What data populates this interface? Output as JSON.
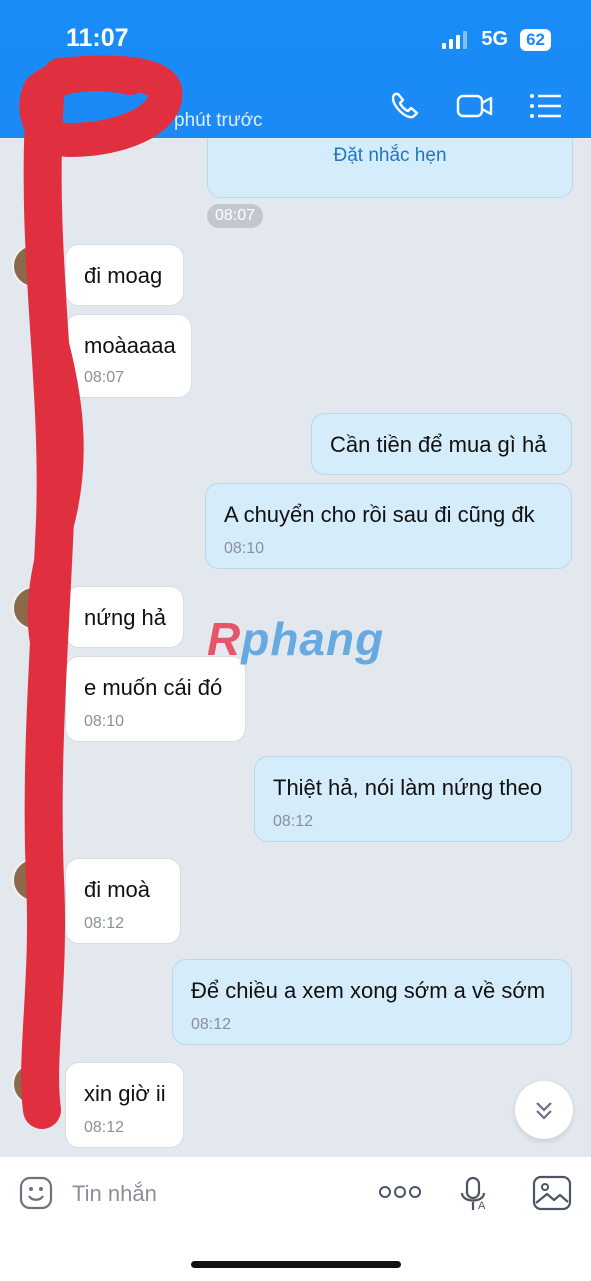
{
  "status_bar": {
    "time": "11:07",
    "network": "5G",
    "battery": "62"
  },
  "header": {
    "subtitle": "phút trước"
  },
  "reminder": {
    "label": "Đặt nhắc hẹn",
    "time": "08:07"
  },
  "messages": [
    {
      "side": "in",
      "text": "đi moag",
      "time": ""
    },
    {
      "side": "in",
      "text": "moàaaaa",
      "time": "08:07"
    },
    {
      "side": "out",
      "text": "Cần tiền để mua gì hả",
      "time": ""
    },
    {
      "side": "out",
      "text": "A chuyển cho rồi sau đi cũng đk",
      "time": "08:10"
    },
    {
      "side": "in",
      "text": "nứng hả",
      "time": ""
    },
    {
      "side": "in",
      "text": "e muốn cái đó",
      "time": "08:10"
    },
    {
      "side": "out",
      "text": "Thiệt hả, nói làm nứng theo",
      "time": "08:12"
    },
    {
      "side": "in",
      "text": "đi moà",
      "time": "08:12"
    },
    {
      "side": "out",
      "text": "Để chiều a xem xong sớm a về sớm",
      "time": "08:12"
    },
    {
      "side": "in",
      "text": "xin giờ ii",
      "time": "08:12"
    }
  ],
  "watermark": {
    "part1": "R",
    "part2": "phang"
  },
  "composer": {
    "placeholder": "Tin nhắn"
  },
  "colors": {
    "header": "#1b8af6",
    "bubble_out": "#d5ecfa",
    "bubble_in": "#ffffff",
    "scribble": "#e03040"
  }
}
